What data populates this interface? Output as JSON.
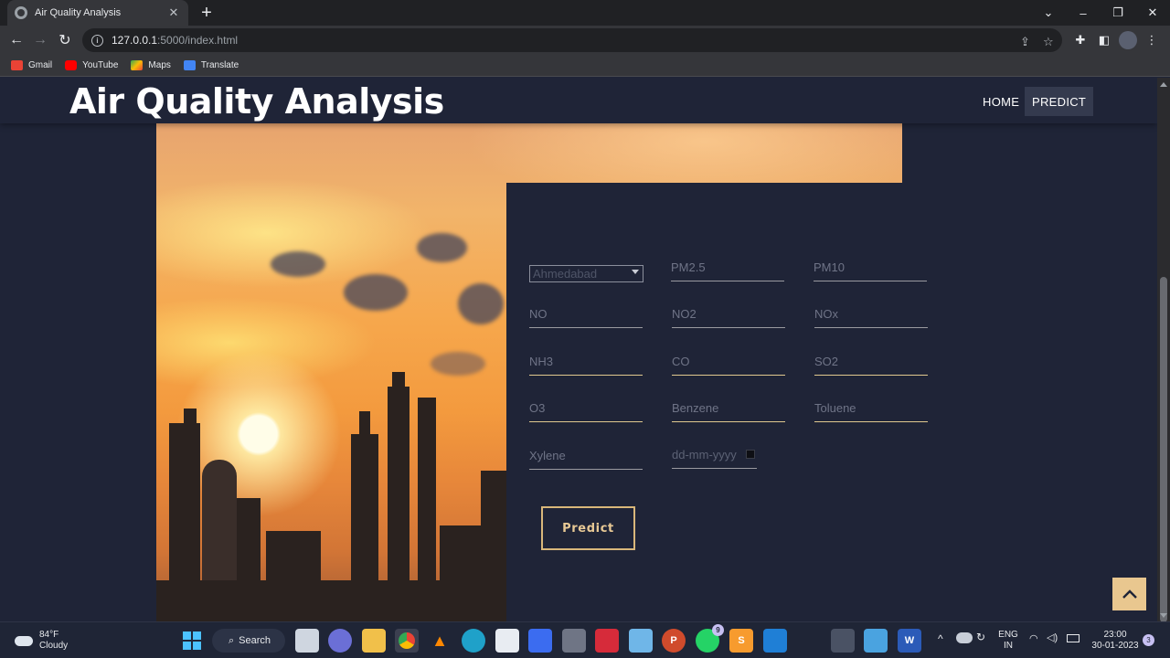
{
  "browser": {
    "tab_title": "Air Quality Analysis",
    "tab_close": "✕",
    "new_tab": "+",
    "url_host": "127.0.0.1",
    "url_rest": ":5000/index.html",
    "bookmarks": [
      {
        "label": "Gmail",
        "color": "#ea4335"
      },
      {
        "label": "YouTube",
        "color": "#ff0000"
      },
      {
        "label": "Maps",
        "color": "#34a853"
      },
      {
        "label": "Translate",
        "color": "#4285f4"
      }
    ]
  },
  "site": {
    "brand": "Air Quality Analysis",
    "nav": [
      {
        "label": "HOME",
        "active": false
      },
      {
        "label": "PREDICT",
        "active": true
      }
    ]
  },
  "form": {
    "city_selected": "Ahmedabad",
    "fields": [
      {
        "placeholder": "PM2.5"
      },
      {
        "placeholder": "PM10"
      },
      {
        "placeholder": "NO"
      },
      {
        "placeholder": "NO2"
      },
      {
        "placeholder": "NOx"
      },
      {
        "placeholder": "NH3"
      },
      {
        "placeholder": "CO"
      },
      {
        "placeholder": "SO2"
      },
      {
        "placeholder": "O3"
      },
      {
        "placeholder": "Benzene"
      },
      {
        "placeholder": "Toluene"
      },
      {
        "placeholder": "Xylene"
      }
    ],
    "date_placeholder": "dd-mm-yyyy",
    "submit_label": "Predict"
  },
  "taskbar": {
    "weather_temp": "84°F",
    "weather_desc": "Cloudy",
    "search_label": "Search",
    "whatsapp_badge": "9",
    "lang_1": "ENG",
    "lang_2": "IN",
    "time": "23:00",
    "date": "30-01-2023",
    "notification_count": "3"
  },
  "colors": {
    "page_bg": "#1f2437",
    "accent_gold": "#e0c98f",
    "nav_active_bg": "#343a4e"
  }
}
